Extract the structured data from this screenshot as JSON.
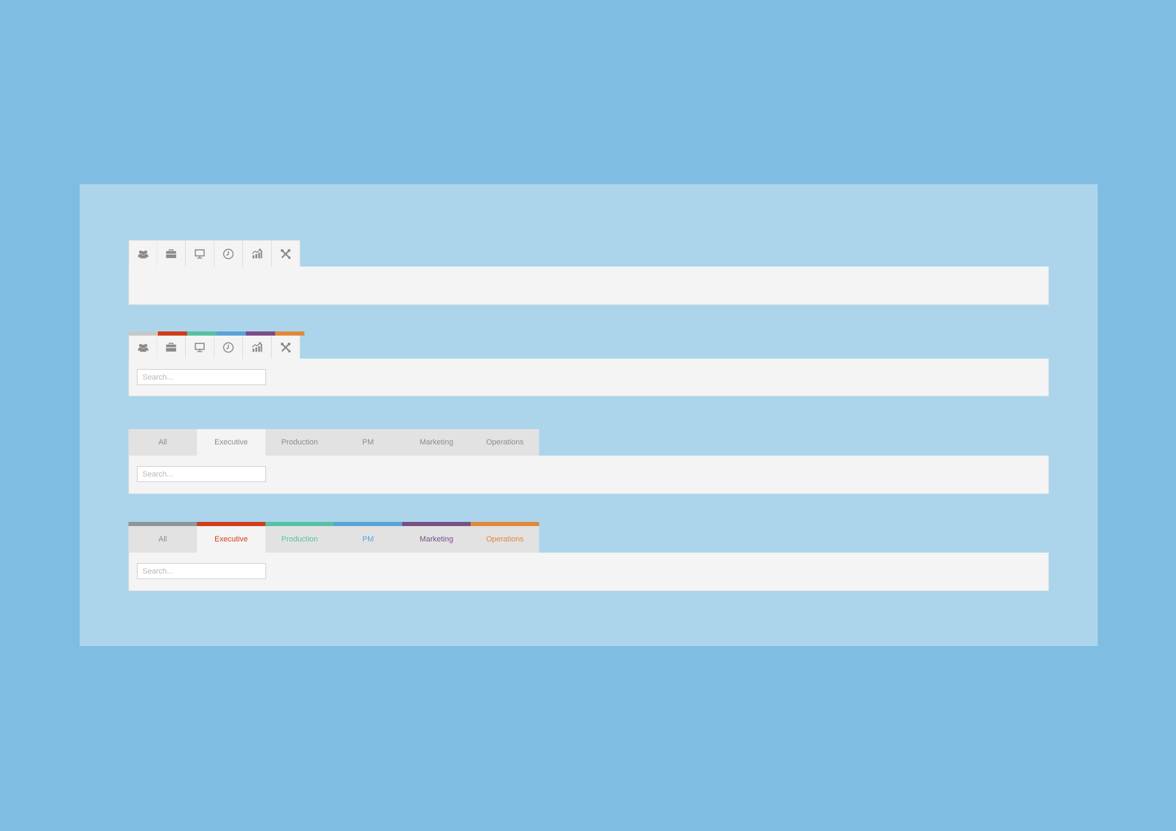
{
  "search": {
    "placeholder": "Search..."
  },
  "icon_tabs": [
    {
      "icon": "users-icon",
      "color": "#c8c8c8"
    },
    {
      "icon": "briefcase-icon",
      "color": "#d13c1a"
    },
    {
      "icon": "monitor-icon",
      "color": "#57c2a3"
    },
    {
      "icon": "clock-icon",
      "color": "#5ba3d6"
    },
    {
      "icon": "chart-icon",
      "color": "#7a4e86"
    },
    {
      "icon": "tools-icon",
      "color": "#e0893a"
    }
  ],
  "text_tabs": {
    "plain": [
      {
        "label": "All"
      },
      {
        "label": "Executive",
        "active": true
      },
      {
        "label": "Production"
      },
      {
        "label": "PM"
      },
      {
        "label": "Marketing"
      },
      {
        "label": "Operations"
      }
    ],
    "colored": [
      {
        "label": "All",
        "color": "#8f959a",
        "text_color": "#8c8c8c"
      },
      {
        "label": "Executive",
        "color": "#d13c1a",
        "text_color": "#d13c1a",
        "active": true
      },
      {
        "label": "Production",
        "color": "#57c2a3",
        "text_color": "#57c2a3"
      },
      {
        "label": "PM",
        "color": "#5ba3d6",
        "text_color": "#5ba3d6"
      },
      {
        "label": "Marketing",
        "color": "#7a4e86",
        "text_color": "#7a4e86"
      },
      {
        "label": "Operations",
        "color": "#e0893a",
        "text_color": "#e0893a"
      }
    ]
  },
  "colors": {
    "page_bg": "#7fbde2",
    "board_bg": "#acd5eb",
    "panel_bg": "#f4f4f4",
    "tab_bg": "#e2e2e2",
    "icon_color": "#8a8a8a"
  }
}
